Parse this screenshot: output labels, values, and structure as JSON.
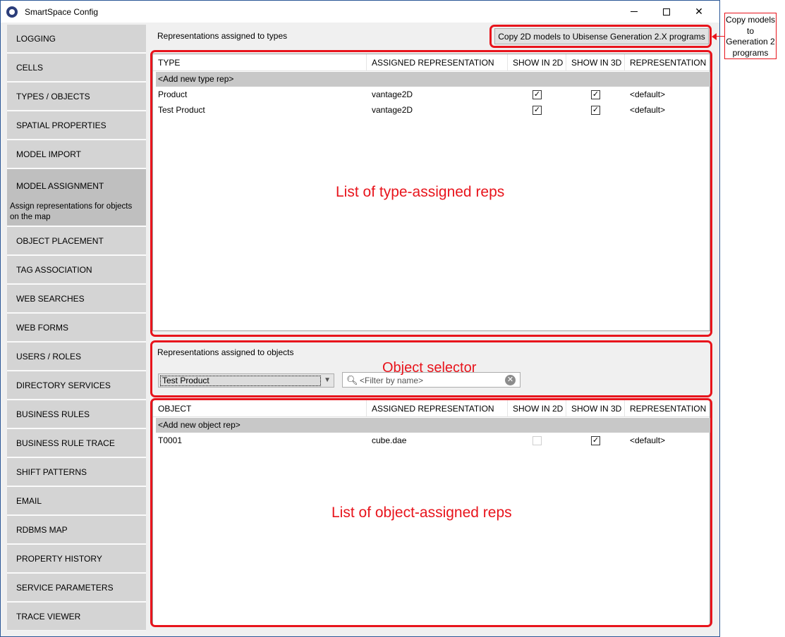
{
  "window": {
    "title": "SmartSpace Config"
  },
  "sidebar": {
    "items": [
      {
        "label": "LOGGING"
      },
      {
        "label": "CELLS"
      },
      {
        "label": "TYPES / OBJECTS"
      },
      {
        "label": "SPATIAL PROPERTIES"
      },
      {
        "label": "MODEL IMPORT"
      },
      {
        "label": "MODEL ASSIGNMENT",
        "description": "Assign representations for objects on the map"
      },
      {
        "label": "OBJECT PLACEMENT"
      },
      {
        "label": "TAG ASSOCIATION"
      },
      {
        "label": "WEB SEARCHES"
      },
      {
        "label": "WEB FORMS"
      },
      {
        "label": "USERS / ROLES"
      },
      {
        "label": "DIRECTORY SERVICES"
      },
      {
        "label": "BUSINESS RULES"
      },
      {
        "label": "BUSINESS RULE TRACE"
      },
      {
        "label": "SHIFT PATTERNS"
      },
      {
        "label": "EMAIL"
      },
      {
        "label": "RDBMS MAP"
      },
      {
        "label": "PROPERTY HISTORY"
      },
      {
        "label": "SERVICE PARAMETERS"
      },
      {
        "label": "TRACE VIEWER"
      }
    ]
  },
  "types_section": {
    "label": "Representations assigned to types",
    "copy_button": "Copy 2D models to Ubisense Generation 2.X programs",
    "columns": [
      "TYPE",
      "ASSIGNED REPRESENTATION",
      "SHOW IN 2D",
      "SHOW IN 3D",
      "REPRESENTATION..."
    ],
    "add_row": "<Add new type rep>",
    "rows": [
      {
        "name": "Product",
        "rep": "vantage2D",
        "show2d": "✓",
        "show3d": "✓",
        "repname": "<default>"
      },
      {
        "name": "Test Product",
        "rep": "vantage2D",
        "show2d": "✓",
        "show3d": "✓",
        "repname": "<default>"
      }
    ]
  },
  "objects_section": {
    "label": "Representations assigned to objects",
    "selected_type": "Test Product",
    "filter_placeholder": "<Filter by name>",
    "columns": [
      "OBJECT",
      "ASSIGNED REPRESENTATION",
      "SHOW IN 2D",
      "SHOW IN 3D",
      "REPRESENTATION..."
    ],
    "add_row": "<Add new object rep>",
    "rows": [
      {
        "name": "T0001",
        "rep": "cube.dae",
        "show2d": "",
        "show3d": "✓",
        "repname": "<default>"
      }
    ]
  },
  "annotations": {
    "copy_callout": "Copy models to Generation 2 programs",
    "type_list": "List of type-assigned reps",
    "object_selector": "Object selector",
    "object_list": "List of object-assigned reps",
    "color": "#e8141c"
  }
}
